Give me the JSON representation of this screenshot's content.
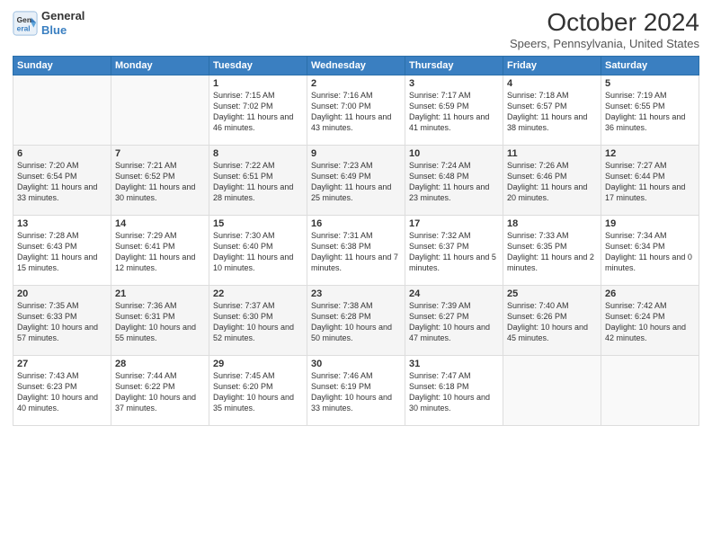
{
  "logo": {
    "line1": "General",
    "line2": "Blue"
  },
  "title": "October 2024",
  "location": "Speers, Pennsylvania, United States",
  "days_of_week": [
    "Sunday",
    "Monday",
    "Tuesday",
    "Wednesday",
    "Thursday",
    "Friday",
    "Saturday"
  ],
  "weeks": [
    [
      {
        "day": "",
        "content": ""
      },
      {
        "day": "",
        "content": ""
      },
      {
        "day": "1",
        "content": "Sunrise: 7:15 AM\nSunset: 7:02 PM\nDaylight: 11 hours and 46 minutes."
      },
      {
        "day": "2",
        "content": "Sunrise: 7:16 AM\nSunset: 7:00 PM\nDaylight: 11 hours and 43 minutes."
      },
      {
        "day": "3",
        "content": "Sunrise: 7:17 AM\nSunset: 6:59 PM\nDaylight: 11 hours and 41 minutes."
      },
      {
        "day": "4",
        "content": "Sunrise: 7:18 AM\nSunset: 6:57 PM\nDaylight: 11 hours and 38 minutes."
      },
      {
        "day": "5",
        "content": "Sunrise: 7:19 AM\nSunset: 6:55 PM\nDaylight: 11 hours and 36 minutes."
      }
    ],
    [
      {
        "day": "6",
        "content": "Sunrise: 7:20 AM\nSunset: 6:54 PM\nDaylight: 11 hours and 33 minutes."
      },
      {
        "day": "7",
        "content": "Sunrise: 7:21 AM\nSunset: 6:52 PM\nDaylight: 11 hours and 30 minutes."
      },
      {
        "day": "8",
        "content": "Sunrise: 7:22 AM\nSunset: 6:51 PM\nDaylight: 11 hours and 28 minutes."
      },
      {
        "day": "9",
        "content": "Sunrise: 7:23 AM\nSunset: 6:49 PM\nDaylight: 11 hours and 25 minutes."
      },
      {
        "day": "10",
        "content": "Sunrise: 7:24 AM\nSunset: 6:48 PM\nDaylight: 11 hours and 23 minutes."
      },
      {
        "day": "11",
        "content": "Sunrise: 7:26 AM\nSunset: 6:46 PM\nDaylight: 11 hours and 20 minutes."
      },
      {
        "day": "12",
        "content": "Sunrise: 7:27 AM\nSunset: 6:44 PM\nDaylight: 11 hours and 17 minutes."
      }
    ],
    [
      {
        "day": "13",
        "content": "Sunrise: 7:28 AM\nSunset: 6:43 PM\nDaylight: 11 hours and 15 minutes."
      },
      {
        "day": "14",
        "content": "Sunrise: 7:29 AM\nSunset: 6:41 PM\nDaylight: 11 hours and 12 minutes."
      },
      {
        "day": "15",
        "content": "Sunrise: 7:30 AM\nSunset: 6:40 PM\nDaylight: 11 hours and 10 minutes."
      },
      {
        "day": "16",
        "content": "Sunrise: 7:31 AM\nSunset: 6:38 PM\nDaylight: 11 hours and 7 minutes."
      },
      {
        "day": "17",
        "content": "Sunrise: 7:32 AM\nSunset: 6:37 PM\nDaylight: 11 hours and 5 minutes."
      },
      {
        "day": "18",
        "content": "Sunrise: 7:33 AM\nSunset: 6:35 PM\nDaylight: 11 hours and 2 minutes."
      },
      {
        "day": "19",
        "content": "Sunrise: 7:34 AM\nSunset: 6:34 PM\nDaylight: 11 hours and 0 minutes."
      }
    ],
    [
      {
        "day": "20",
        "content": "Sunrise: 7:35 AM\nSunset: 6:33 PM\nDaylight: 10 hours and 57 minutes."
      },
      {
        "day": "21",
        "content": "Sunrise: 7:36 AM\nSunset: 6:31 PM\nDaylight: 10 hours and 55 minutes."
      },
      {
        "day": "22",
        "content": "Sunrise: 7:37 AM\nSunset: 6:30 PM\nDaylight: 10 hours and 52 minutes."
      },
      {
        "day": "23",
        "content": "Sunrise: 7:38 AM\nSunset: 6:28 PM\nDaylight: 10 hours and 50 minutes."
      },
      {
        "day": "24",
        "content": "Sunrise: 7:39 AM\nSunset: 6:27 PM\nDaylight: 10 hours and 47 minutes."
      },
      {
        "day": "25",
        "content": "Sunrise: 7:40 AM\nSunset: 6:26 PM\nDaylight: 10 hours and 45 minutes."
      },
      {
        "day": "26",
        "content": "Sunrise: 7:42 AM\nSunset: 6:24 PM\nDaylight: 10 hours and 42 minutes."
      }
    ],
    [
      {
        "day": "27",
        "content": "Sunrise: 7:43 AM\nSunset: 6:23 PM\nDaylight: 10 hours and 40 minutes."
      },
      {
        "day": "28",
        "content": "Sunrise: 7:44 AM\nSunset: 6:22 PM\nDaylight: 10 hours and 37 minutes."
      },
      {
        "day": "29",
        "content": "Sunrise: 7:45 AM\nSunset: 6:20 PM\nDaylight: 10 hours and 35 minutes."
      },
      {
        "day": "30",
        "content": "Sunrise: 7:46 AM\nSunset: 6:19 PM\nDaylight: 10 hours and 33 minutes."
      },
      {
        "day": "31",
        "content": "Sunrise: 7:47 AM\nSunset: 6:18 PM\nDaylight: 10 hours and 30 minutes."
      },
      {
        "day": "",
        "content": ""
      },
      {
        "day": "",
        "content": ""
      }
    ]
  ]
}
